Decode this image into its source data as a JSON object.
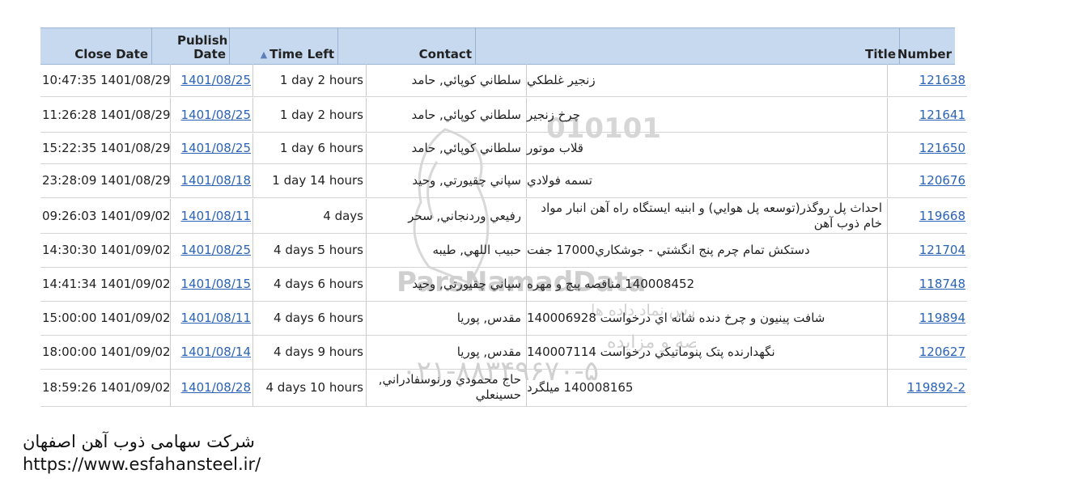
{
  "header": {
    "close_date": "Close Date",
    "publish_date": "Publish Date",
    "time_left": "Time Left",
    "contact": "Contact",
    "title": "Title",
    "number": "Number"
  },
  "rows": [
    {
      "close": "10:47:35 1401/08/29",
      "publish": "1401/08/25",
      "left": "1 day 2 hours",
      "contact": "سلطاني کوپائي, حامد",
      "title": "زنجير غلطکي",
      "number": "121638"
    },
    {
      "close": "11:26:28 1401/08/29",
      "publish": "1401/08/25",
      "left": "1 day 2 hours",
      "contact": "سلطاني کوپائي, حامد",
      "title": "چرخ زنجير",
      "number": "121641"
    },
    {
      "close": "15:22:35 1401/08/29",
      "publish": "1401/08/25",
      "left": "1 day 6 hours",
      "contact": "سلطاني کوپائي, حامد",
      "title": "قلاب موتور",
      "number": "121650"
    },
    {
      "close": "23:28:09 1401/08/29",
      "publish": "1401/08/18",
      "left": "1 day 14 hours",
      "contact": "سپاني چقيورتي, وحيد",
      "title": "تسمه فولادي",
      "number": "120676"
    },
    {
      "close": "09:26:03 1401/09/02",
      "publish": "1401/08/11",
      "left": "4 days",
      "contact": "رفيعي وردنجاني, سحر",
      "title": "احداث پل روگذر(توسعه پل هوايي) و ابنيه ايستگاه راه آهن انبار مواد خام ذوب آهن",
      "number": "119668"
    },
    {
      "close": "14:30:30 1401/09/02",
      "publish": "1401/08/25",
      "left": "4 days 5 hours",
      "contact": "حبيب اللهي, طيبه",
      "title": "دستکش تمام چرم پنج انگشتي - جوشکاري17000 جفت",
      "number": "121704"
    },
    {
      "close": "14:41:34 1401/09/02",
      "publish": "1401/08/15",
      "left": "4 days 6 hours",
      "contact": "سپاني چقيورتي, وحيد",
      "title": "140008452 مناقصه پيچ و مهره",
      "number": "118748"
    },
    {
      "close": "15:00:00 1401/09/02",
      "publish": "1401/08/11",
      "left": "4 days 6 hours",
      "contact": "مقدس, پوريا",
      "title": "شافت پينيون و چرخ دنده شانه اي درخواست 140006928",
      "number": "119894"
    },
    {
      "close": "18:00:00 1401/09/02",
      "publish": "1401/08/14",
      "left": "4 days 9 hours",
      "contact": "مقدس, پوريا",
      "title": "نگهدارنده پتک پنوماتيکي درخواست 140007114",
      "number": "120627"
    },
    {
      "close": "18:59:26 1401/09/02",
      "publish": "1401/08/28",
      "left": "4 days 10 hours",
      "contact": "حاج محمودي ورنوسفادراني, حسينعلي",
      "title": "140008165 ميلگرد",
      "number": "119892-2"
    }
  ],
  "watermark": {
    "brand": "ParsNamadData",
    "digits": "010101",
    "phone": "۰۲۱-۸۸۳۴۹۶۷۰-۵",
    "line1": "مرکز آموزش اطلاعات پارس نماد داده ها",
    "line2": "پایگاه اطلاع رسانی مناقصه و مزایده"
  },
  "footer": {
    "company": "شرکت سهامی ذوب آهن اصفهان",
    "url": "https://www.esfahansteel.ir/"
  }
}
